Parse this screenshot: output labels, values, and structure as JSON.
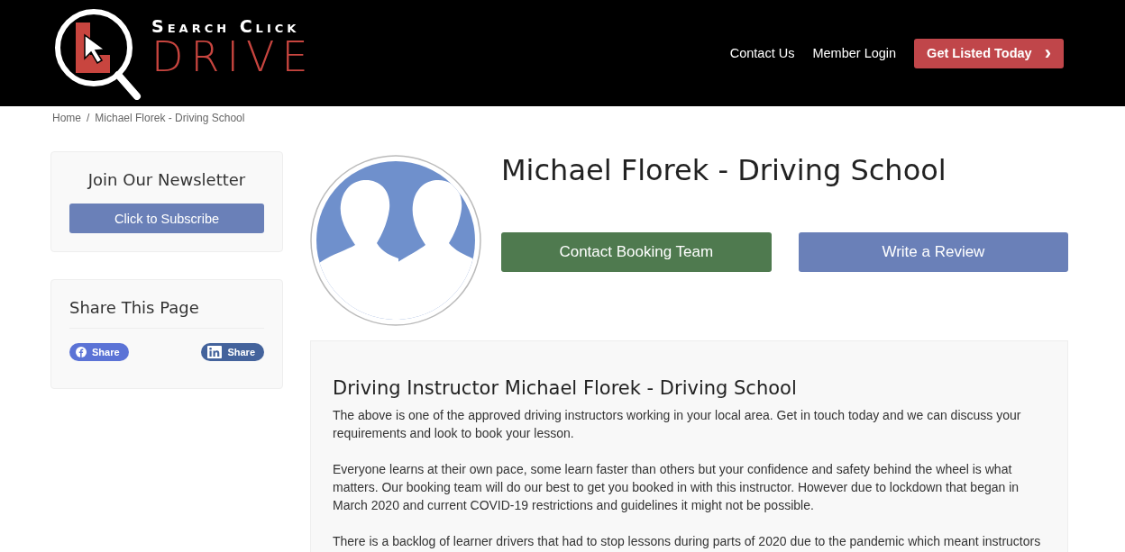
{
  "header": {
    "logo": {
      "line_1": "Search Click",
      "line_2": "DRIVE"
    },
    "nav": [
      "Contact Us",
      "Member Login"
    ],
    "cta": {
      "label": "Get Listed Today",
      "icon": "›"
    }
  },
  "breadcrumb": {
    "separator": "/",
    "items": [
      "Home",
      "Michael Florek - Driving School"
    ]
  },
  "sidebar": {
    "newsletter": {
      "title": "Join Our Newsletter",
      "button": "Click to Subscribe"
    },
    "share": {
      "title": "Share This Page",
      "buttons": [
        {
          "kind": "facebook",
          "label": "Share"
        },
        {
          "kind": "linkedin",
          "label": "Share"
        }
      ]
    }
  },
  "profile": {
    "name": "Michael Florek - Driving School",
    "buttons": [
      {
        "kind": "contact",
        "label": "Contact Booking Team"
      },
      {
        "kind": "review",
        "label": "Write a Review"
      }
    ]
  },
  "about": {
    "heading": "Driving Instructor Michael Florek - Driving School",
    "paragraphs": [
      "The above is one of the approved driving instructors working in your local area. Get in touch today and we can discuss your requirements and look to book your lesson.",
      "Everyone learns at their own pace, some learn faster than others but your confidence and safety behind the wheel is what matters. Our booking team will do our best to get you booked in with this instructor. However due to lockdown that began in March 2020 and current COVID-19 restrictions and guidelines it might not be possible.",
      "There is a backlog of learner drivers that had to stop lessons during parts of 2020 due to the pandemic which meant instructors"
    ]
  }
}
